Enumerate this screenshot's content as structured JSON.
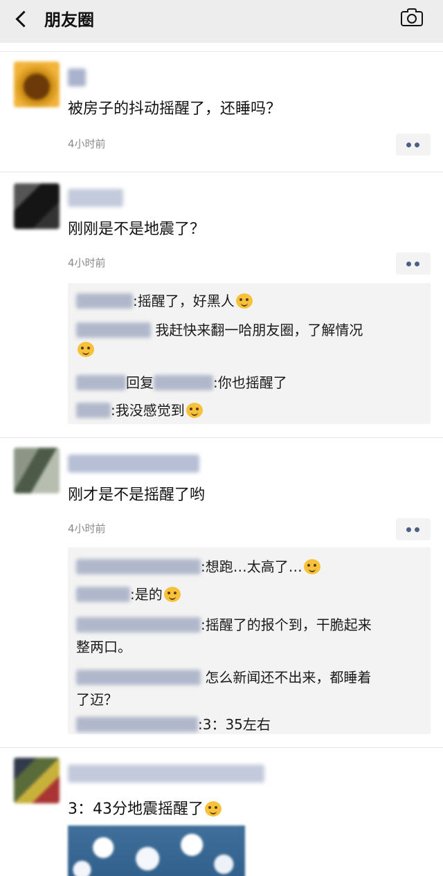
{
  "header": {
    "title": "朋友圈",
    "back_icon": "back-arrow-icon",
    "camera_icon": "camera-icon"
  },
  "posts": [
    {
      "text": "被房子的抖动摇醒了，还睡吗？",
      "time": "4小时前",
      "avatar_colors": [
        "#c98a10",
        "#f2b43a",
        "#7a3e06"
      ]
    },
    {
      "text": "刚刚是不是地震了？",
      "time": "4小时前",
      "avatar_colors": [
        "#3a3a3a",
        "#111111",
        "#d84a4a"
      ],
      "comments": [
        {
          "tail": ":摇醒了，好黑人",
          "emoji": "smirk-emoji"
        },
        {
          "tail": " 我赶快来翻一哈朋友圈，了解情况",
          "emoji": "tears-of-joy-emoji"
        },
        {
          "tail": "回复",
          "tail2": ":你也摇醒了"
        },
        {
          "tail": ":我没感觉到",
          "emoji": "sob-emoji"
        }
      ]
    },
    {
      "text": "刚才是不是摇醒了哟",
      "time": "4小时前",
      "avatar_colors": [
        "#6f7a6a",
        "#a3ac9c",
        "#4d5a48"
      ],
      "comments": [
        {
          "tail": ":想跑…太高了…",
          "emoji": "thinking-emoji"
        },
        {
          "tail": ":是的",
          "emoji": "sob-emoji"
        },
        {
          "tail": ":摇醒了的报个到，干脆起来",
          "line2": "整两口。"
        },
        {
          "tail": " 怎么新闻还不出来，都睡着",
          "line2": "了迈？"
        },
        {
          "tail": ":3：35左右"
        }
      ]
    },
    {
      "text": "3：43分地震摇醒了",
      "emoji": "shocked-emoji",
      "avatar_colors": [
        "#5a6b3a",
        "#c7b13a",
        "#2f3a4a"
      ]
    }
  ],
  "colors": {
    "link": "#576b95",
    "time": "#8a8a8a",
    "comment_bg": "#f3f3f3",
    "header_bg": "#ededed"
  }
}
